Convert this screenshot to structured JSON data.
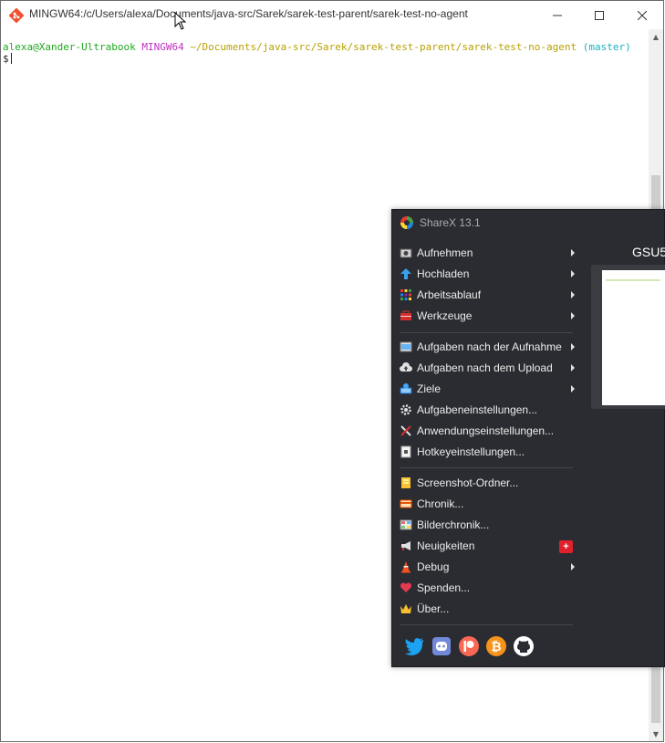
{
  "terminal": {
    "title": "MINGW64:/c/Users/alexa/Documents/java-src/Sarek/sarek-test-parent/sarek-test-no-agent",
    "prompt_user": "alexa@Xander-Ultrabook",
    "prompt_env": "MINGW64",
    "prompt_path": "~/Documents/java-src/Sarek/sarek-test-parent/sarek-test-no-agent",
    "prompt_branch": "(master)",
    "prompt_symbol": "$",
    "colors": {
      "user": "#1ea81e",
      "env": "#c030c0",
      "path": "#b8a000",
      "branch": "#1ab0c0"
    }
  },
  "sharex": {
    "title": "ShareX 13.1",
    "preview_label": "GSU5",
    "menu": [
      {
        "label": "Aufnehmen",
        "icon": "camera-icon",
        "submenu": true
      },
      {
        "label": "Hochladen",
        "icon": "upload-arrow-icon",
        "submenu": true
      },
      {
        "label": "Arbeitsablauf",
        "icon": "grid-dots-icon",
        "submenu": true
      },
      {
        "label": "Werkzeuge",
        "icon": "toolbox-icon",
        "submenu": true
      },
      {
        "label": "Aufgaben nach der Aufnahme",
        "icon": "image-task-icon",
        "submenu": true
      },
      {
        "label": "Aufgaben nach dem Upload",
        "icon": "cloud-upload-icon",
        "submenu": true
      },
      {
        "label": "Ziele",
        "icon": "destinations-icon",
        "submenu": true
      },
      {
        "label": "Aufgabeneinstellungen...",
        "icon": "gear-icon",
        "submenu": false
      },
      {
        "label": "Anwendungseinstellungen...",
        "icon": "tools-icon",
        "submenu": false
      },
      {
        "label": "Hotkeyeinstellungen...",
        "icon": "keyboard-icon",
        "submenu": false
      },
      {
        "label": "Screenshot-Ordner...",
        "icon": "folder-icon",
        "submenu": false
      },
      {
        "label": "Chronik...",
        "icon": "history-card-icon",
        "submenu": false
      },
      {
        "label": "Bilderchronik...",
        "icon": "image-history-icon",
        "submenu": false
      },
      {
        "label": "Neuigkeiten",
        "icon": "megaphone-icon",
        "submenu": false,
        "badge": "+"
      },
      {
        "label": "Debug",
        "icon": "traffic-cone-icon",
        "submenu": true
      },
      {
        "label": "Spenden...",
        "icon": "heart-icon",
        "submenu": false
      },
      {
        "label": "Über...",
        "icon": "crown-icon",
        "submenu": false
      }
    ],
    "social": [
      "twitter-icon",
      "discord-icon",
      "patreon-icon",
      "bitcoin-icon",
      "github-icon"
    ]
  }
}
